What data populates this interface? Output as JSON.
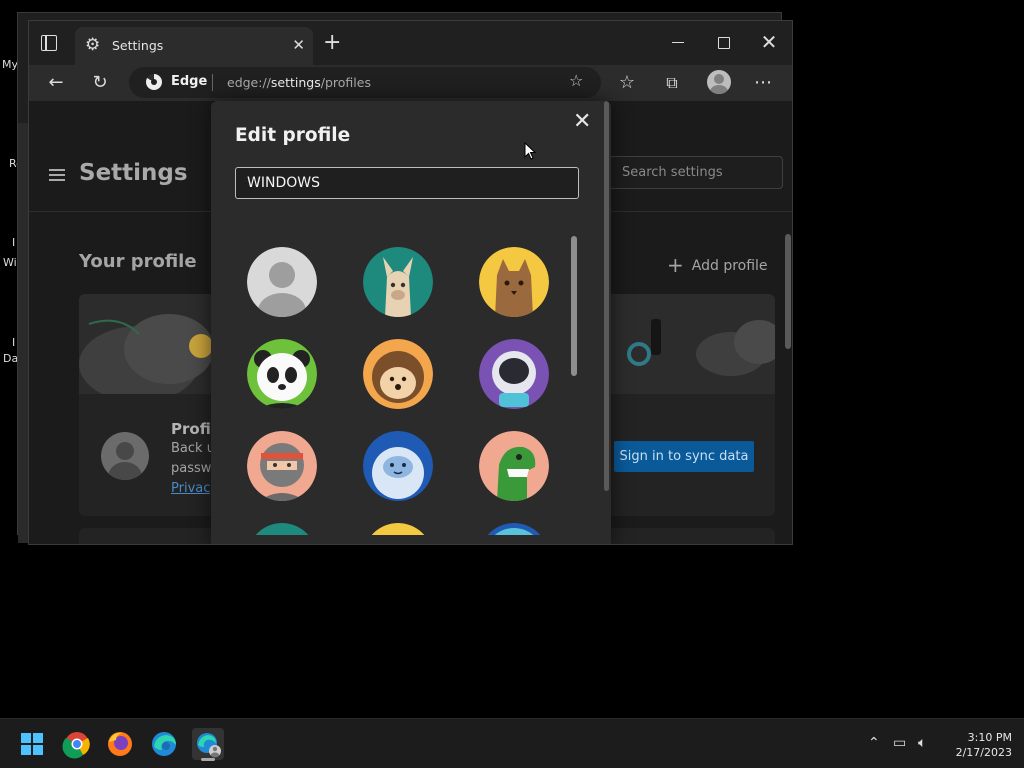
{
  "desktop": {
    "labels": [
      "My",
      "Re",
      "I",
      "Wi",
      "I",
      "Da"
    ]
  },
  "browser": {
    "tab": {
      "title": "Settings"
    },
    "address": {
      "brand": "Edge",
      "url_prefix": "edge://",
      "url_strong": "settings",
      "url_suffix": "/profiles"
    }
  },
  "settings": {
    "title": "Settings",
    "search_placeholder": "Search settings",
    "your_profile_heading": "Your profile",
    "add_profile_label": "Add profile",
    "card": {
      "profile_label": "Profil",
      "backup_text": "Back u",
      "password_text": "passw",
      "privacy_link": "Privacy"
    },
    "sync_button": "Sign in to sync data"
  },
  "dialog": {
    "title": "Edit profile",
    "name_value": "WINDOWS",
    "avatars": [
      "default-person-avatar",
      "llama-avatar",
      "cat-avatar",
      "panda-avatar",
      "hedgehog-avatar",
      "astronaut-avatar",
      "ninja-avatar",
      "yeti-avatar",
      "dinosaur-avatar",
      "teal-avatar-partial",
      "yellow-avatar-partial",
      "blue-ring-avatar-partial"
    ]
  },
  "taskbar": {
    "apps": [
      "start-icon",
      "chrome-icon",
      "firefox-icon",
      "edge-icon",
      "edge-profile-icon"
    ],
    "time": "3:10 PM",
    "date": "2/17/2023"
  },
  "colors": {
    "accent": "#0a5a9a",
    "windows_blue": "#4cc2ff",
    "dialog_bg": "#2b2b2b"
  }
}
